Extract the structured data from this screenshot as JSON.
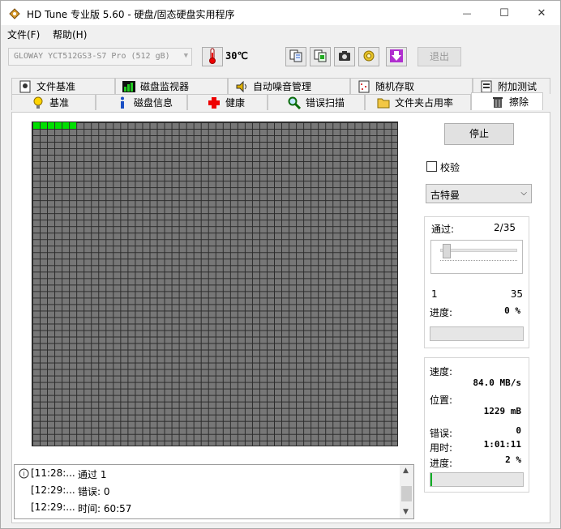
{
  "window": {
    "title": "HD Tune 专业版 5.60 - 硬盘/固态硬盘实用程序",
    "minimize_glyph": "—",
    "maximize_glyph": "☐",
    "close_glyph": "✕"
  },
  "menu": {
    "file": "文件(F)",
    "help": "帮助(H)"
  },
  "toolbar": {
    "drive": "GLOWAY YCT512GS3-S7 Pro (512 gB)",
    "temperature": "30℃",
    "exit_label": "退出",
    "icons": [
      "thermometer-icon",
      "copy-info-icon",
      "copy-screen-icon",
      "camera-icon",
      "options-icon",
      "download-icon"
    ]
  },
  "tabs_top": [
    {
      "label": "文件基准",
      "icon": "file-benchmark-icon"
    },
    {
      "label": "磁盘监视器",
      "icon": "disk-monitor-icon"
    },
    {
      "label": "自动噪音管理",
      "icon": "speaker-icon"
    },
    {
      "label": "随机存取",
      "icon": "random-access-icon"
    },
    {
      "label": "附加测试",
      "icon": "extra-tests-icon"
    }
  ],
  "tabs_bottom": [
    {
      "label": "基准",
      "icon": "bulb-icon"
    },
    {
      "label": "磁盘信息",
      "icon": "info-icon"
    },
    {
      "label": "健康",
      "icon": "health-cross-icon"
    },
    {
      "label": "错误扫描",
      "icon": "magnifier-icon"
    },
    {
      "label": "文件夹占用率",
      "icon": "folder-icon"
    },
    {
      "label": "擦除",
      "icon": "trash-icon",
      "active": true
    }
  ],
  "erase": {
    "stop_label": "停止",
    "verify_label": "校验",
    "verify_checked": false,
    "method": "古特曼",
    "completed_blocks": 6,
    "pass_label": "通过:",
    "pass_value": "2/35",
    "slider_min": "1",
    "slider_max": "35",
    "slider_fraction": 0.03,
    "pass_progress_label": "进度:",
    "pass_progress_value": "0 %",
    "pass_progress_fraction": 0.0,
    "speed_label": "速度:",
    "speed_value": "84.0 MB/s",
    "position_label": "位置:",
    "position_value": "1229 mB",
    "errors_label": "错误:",
    "errors_value": "0",
    "elapsed_label": "用时:",
    "elapsed_value": "1:01:11",
    "total_progress_label": "进度:",
    "total_progress_value": "2 %",
    "total_progress_fraction": 0.02
  },
  "log": [
    {
      "time": "[11:28:...",
      "text": "通过 1"
    },
    {
      "time": "[12:29:...",
      "text": "错误: 0"
    },
    {
      "time": "[12:29:...",
      "text": "时间: 60:57"
    }
  ],
  "colors": {
    "block_done": "#00e000",
    "block_pending": "#777777",
    "progress_fill": "#06b025"
  }
}
